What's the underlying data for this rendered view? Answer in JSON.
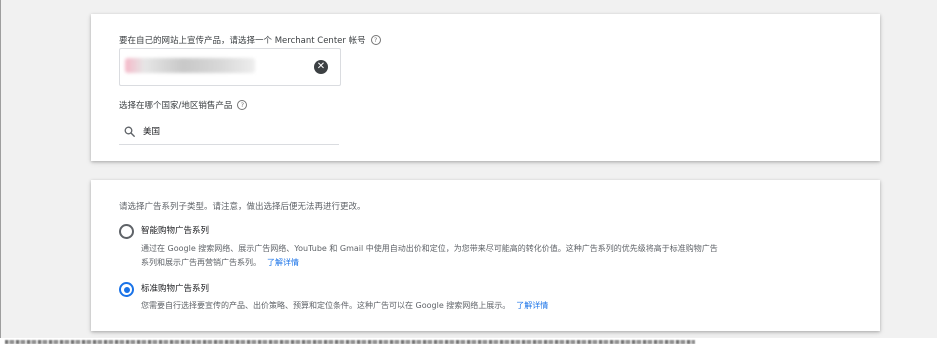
{
  "merchant": {
    "account_label": "要在自己的网站上宣传产品，请选择一个 Merchant Center 帐号",
    "help_glyph": "?",
    "clear_glyph": "✕"
  },
  "country": {
    "label": "选择在哪个国家/地区销售产品",
    "help_glyph": "?",
    "value": "美国"
  },
  "subtype": {
    "instruction": "请选择广告系列子类型。请注意，做出选择后便无法再进行更改。",
    "options": [
      {
        "title": "智能购物广告系列",
        "desc": "通过在 Google 搜索网络、展示广告网络、YouTube 和 Gmail 中使用自动出价和定位，为您带来尽可能高的转化价值。这种广告系列的优先级将高于标准购物广告系列和展示广告再营销广告系列。",
        "link": "了解详情",
        "selected": false
      },
      {
        "title": "标准购物广告系列",
        "desc": "您需要自行选择要宣传的产品、出价策略、预算和定位条件。这种广告可以在 Google 搜索网络上展示。",
        "link": "了解详情",
        "selected": true
      }
    ]
  },
  "colors": {
    "accent": "#1a73e8",
    "background": "#f1f1f1",
    "card": "#ffffff"
  }
}
